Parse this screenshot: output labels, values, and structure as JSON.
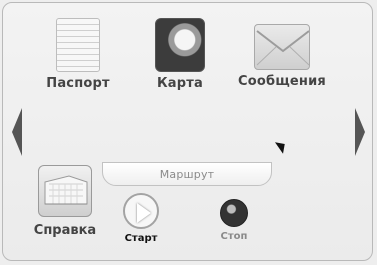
{
  "tiles": [
    {
      "label": "Паспорт",
      "icon": "passport-icon"
    },
    {
      "label": "Карта",
      "icon": "map-icon"
    },
    {
      "label": "Сообщения",
      "icon": "envelope-icon"
    }
  ],
  "route": {
    "label": "Маршрут"
  },
  "help": {
    "label": "Справка",
    "icon": "building-icon"
  },
  "start": {
    "label": "Старт",
    "icon": "play-icon"
  },
  "stop": {
    "label": "Стоп",
    "icon": "stop-icon"
  }
}
